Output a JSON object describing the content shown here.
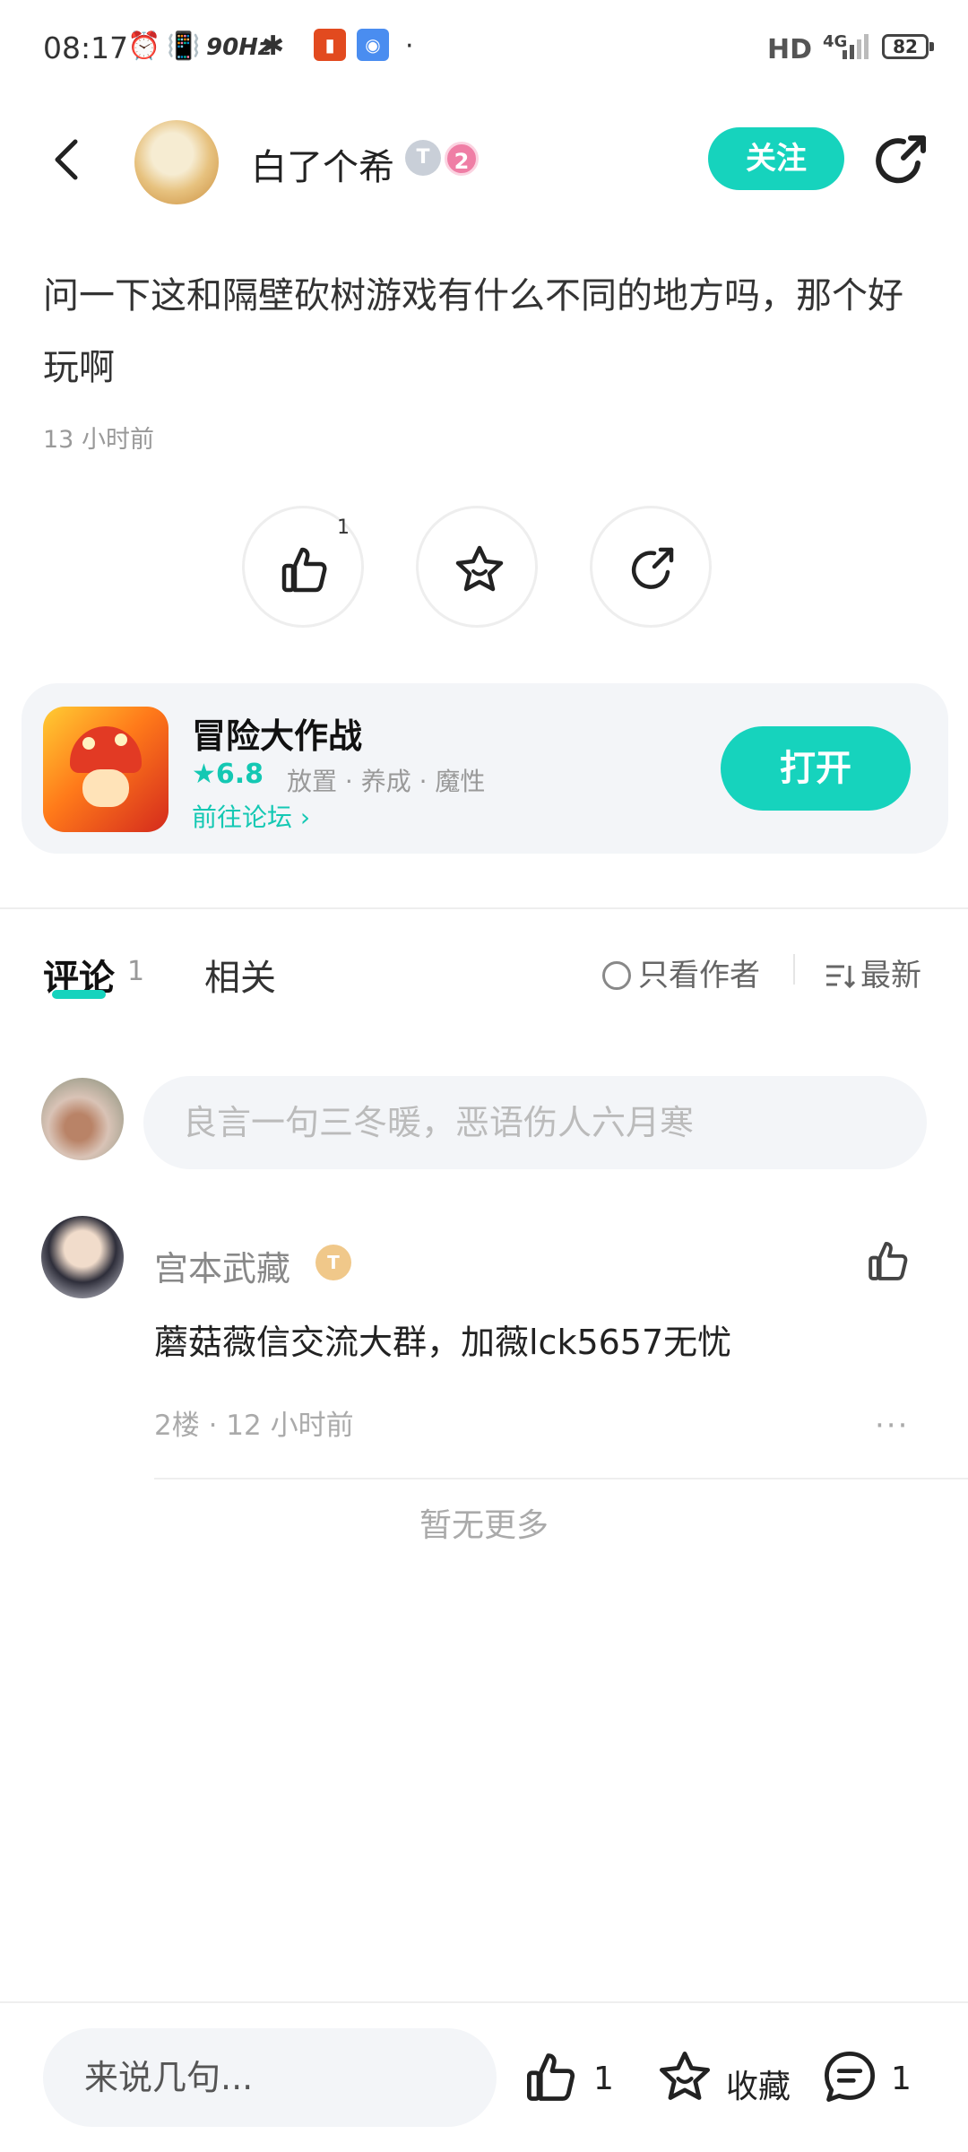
{
  "status_bar": {
    "time": "08:17",
    "refresh_rate": "90Hz",
    "network_label": "HD",
    "signal_label": "4G",
    "battery": "82"
  },
  "header": {
    "author_name": "白了个希",
    "level_badge": "T",
    "rank_badge": "2",
    "follow_label": "关注"
  },
  "post": {
    "text": "问一下这和隔壁砍树游戏有什么不同的地方吗，那个好玩啊",
    "time": "13 小时前",
    "like_count": "1"
  },
  "game_card": {
    "name": "冒险大作战",
    "score": "★6.8",
    "tags": "放置 · 养成 · 魔性",
    "forum_link": "前往论坛 ›",
    "open_label": "打开"
  },
  "tabs": {
    "comments_label": "评论",
    "comments_count": "1",
    "related_label": "相关",
    "only_author_label": "只看作者",
    "sort_label": "最新"
  },
  "comment_input": {
    "placeholder": "良言一句三冬暖，恶语伤人六月寒"
  },
  "comments": [
    {
      "user": "宫本武藏",
      "badge": "T",
      "text": "蘑菇薇信交流大群，加薇lck5657无忧",
      "meta": "2楼 · 12 小时前",
      "more": "···"
    }
  ],
  "no_more_text": "暂无更多",
  "bottom_bar": {
    "input_placeholder": "来说几句...",
    "like_count": "1",
    "favorite_label": "收藏",
    "comment_count": "1"
  },
  "colors": {
    "accent": "#16d3bd",
    "accent_text": "#14c8b3"
  }
}
